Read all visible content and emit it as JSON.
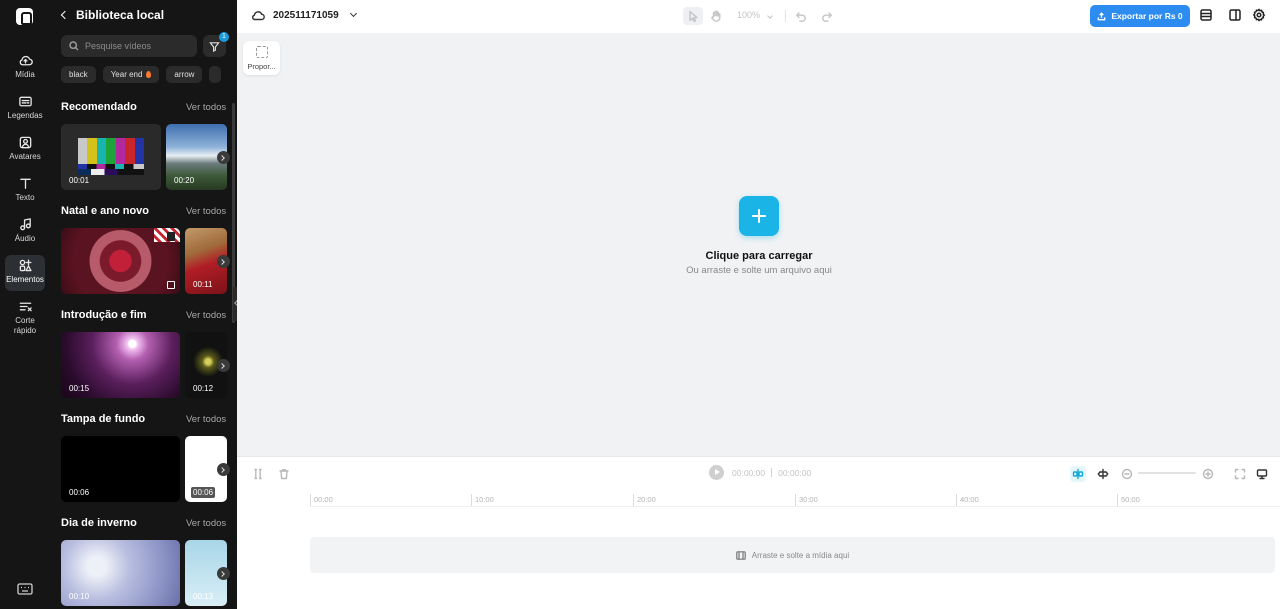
{
  "rail": {
    "items": [
      {
        "label": "Mídia",
        "icon": "cloud-upload-icon"
      },
      {
        "label": "Legendas",
        "icon": "captions-icon"
      },
      {
        "label": "Avatares",
        "icon": "avatar-icon"
      },
      {
        "label": "Texto",
        "icon": "text-icon"
      },
      {
        "label": "Áudio",
        "icon": "music-note-icon"
      },
      {
        "label": "Elementos",
        "icon": "elements-icon",
        "active": true
      },
      {
        "label": "Corte rápido",
        "icon": "scissors-icon"
      }
    ],
    "bottom_icon": "keyboard-icon"
  },
  "panel": {
    "title": "Biblioteca local",
    "search_placeholder": "Pesquise vídeos",
    "filter_badge": "1",
    "chips": [
      "black",
      "Year end",
      "arrow"
    ],
    "see_all": "Ver todos",
    "sections": [
      {
        "title": "Recomendado",
        "durations": [
          "00:01",
          "00:20"
        ]
      },
      {
        "title": "Natal e ano novo",
        "durations": [
          "",
          "00:11"
        ]
      },
      {
        "title": "Introdução e fim",
        "durations": [
          "00:15",
          "00:12"
        ]
      },
      {
        "title": "Tampa de fundo",
        "durations": [
          "00:06",
          "00:06"
        ]
      },
      {
        "title": "Dia de inverno",
        "durations": [
          "00:10",
          "00:13"
        ]
      }
    ]
  },
  "topbar": {
    "project_name": "202511171059",
    "zoom": "100%",
    "export_label": "Exportar por Rs 0"
  },
  "canvas": {
    "ratio_label": "Propor...",
    "upload_title": "Clique para carregar",
    "upload_subtitle": "Ou arraste e solte um arquivo aqui"
  },
  "timeline": {
    "current_time": "00:00:00",
    "total_time": "00:00:00",
    "ruler_ticks": [
      "00:00",
      "10:00",
      "20:00",
      "30:00",
      "40:00",
      "50:00"
    ],
    "drop_hint": "Arraste e solte a mídia aqui"
  },
  "colors": {
    "accent": "#1ab4e6",
    "export_button": "#2d8cf0",
    "sidebar_bg": "#151515"
  }
}
